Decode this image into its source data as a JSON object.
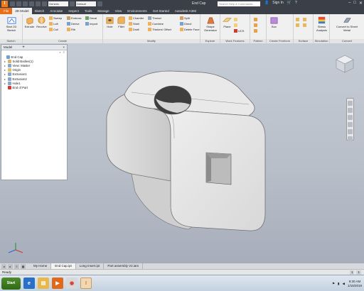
{
  "title_bar": {
    "app_icon": "I",
    "quick_access_selects": [
      "Generic",
      "Default"
    ],
    "document_title": "End Cap",
    "search_placeholder": "Search Help & Commands...",
    "sign_in": "Sign In",
    "help": "?",
    "minimize": "–",
    "maximize": "□",
    "close": "✕"
  },
  "tabs": [
    {
      "label": "File",
      "kind": "file"
    },
    {
      "label": "3D Model",
      "kind": "active"
    },
    {
      "label": "Sketch",
      "kind": ""
    },
    {
      "label": "Annotate",
      "kind": ""
    },
    {
      "label": "Inspect",
      "kind": ""
    },
    {
      "label": "Tools",
      "kind": ""
    },
    {
      "label": "Manage",
      "kind": ""
    },
    {
      "label": "View",
      "kind": ""
    },
    {
      "label": "Environments",
      "kind": ""
    },
    {
      "label": "Get Started",
      "kind": ""
    },
    {
      "label": "Autodesk A360",
      "kind": ""
    }
  ],
  "ribbon": {
    "sketch_panel": {
      "title": "Sketch",
      "start_sketch": "Start 2D Sketch"
    },
    "create_panel": {
      "title": "Create",
      "extrude": "Extrude",
      "revolve": "Revolve",
      "sweep": "Sweep",
      "emboss": "Emboss",
      "decal": "Decal",
      "loft": "Loft",
      "derive": "Derive",
      "import": "Import",
      "coil": "Coil",
      "rib": "Rib"
    },
    "modify_panel": {
      "title": "Modify",
      "hole": "Hole",
      "fillet": "Fillet",
      "chamfer": "Chamfer",
      "shell": "Shell",
      "draft": "Draft",
      "thread": "Thread",
      "combine": "Combine",
      "thicken_offset": "Thicken/ Offset",
      "split": "Split",
      "direct": "Direct",
      "delete_face": "Delete Face"
    },
    "explore_panel": {
      "title": "Explore",
      "shape_generator": "Shape Generator"
    },
    "work_features_panel": {
      "title": "Work Features",
      "plane": "Plane",
      "ucs": "UCS"
    },
    "pattern_panel": {
      "title": "Pattern"
    },
    "freeform_panel": {
      "title": "Create Freeform",
      "box": "Box"
    },
    "surface_panel": {
      "title": "Surface"
    },
    "simulation_panel": {
      "title": "Simulation",
      "stress_analysis": "Stress Analysis"
    },
    "convert_panel": {
      "title": "Convert",
      "convert_sheet_metal": "Convert to Sheet Metal"
    }
  },
  "browser": {
    "title": "Model",
    "add": "+",
    "close": "×",
    "items": [
      {
        "label": "End Cap",
        "indent": 0,
        "toggle": "",
        "color": "#6f9fd8"
      },
      {
        "label": "Solid Bodies(1)",
        "indent": 1,
        "toggle": "▸",
        "color": "#d9b36a"
      },
      {
        "label": "View: Master",
        "indent": 1,
        "toggle": "▸",
        "color": "#7fa7d6"
      },
      {
        "label": "Origin",
        "indent": 1,
        "toggle": "▸",
        "color": "#e0c06a"
      },
      {
        "label": "Extrusion1",
        "indent": 1,
        "toggle": "▸",
        "color": "#8aa6c8"
      },
      {
        "label": "Extrusion2",
        "indent": 1,
        "toggle": "▸",
        "color": "#8aa6c8"
      },
      {
        "label": "Hole1",
        "indent": 1,
        "toggle": "▸",
        "color": "#8aa6c8"
      },
      {
        "label": "End of Part",
        "indent": 1,
        "toggle": "",
        "color": "#d33a2c"
      }
    ]
  },
  "document_tabs": [
    {
      "label": "My Home",
      "active": false
    },
    {
      "label": "End Cap.ipt",
      "active": true
    },
    {
      "label": "Long Insert.ipt",
      "active": false
    },
    {
      "label": "Part assembly V2.iam",
      "active": false
    }
  ],
  "status": {
    "text": "Ready",
    "count_a": "1",
    "count_b": "1"
  },
  "taskbar": {
    "start_label": "Start",
    "apps": [
      "ie",
      "windows-explorer",
      "media-player",
      "chrome",
      "inventor"
    ],
    "time": "9:30 AM",
    "date": "1/15/2019"
  },
  "colors": {
    "accent_orange": "#e8701a",
    "title_dark": "#3a3f48",
    "model_face": "#e7e7e7",
    "viewport_top": "#c6ccd5"
  }
}
